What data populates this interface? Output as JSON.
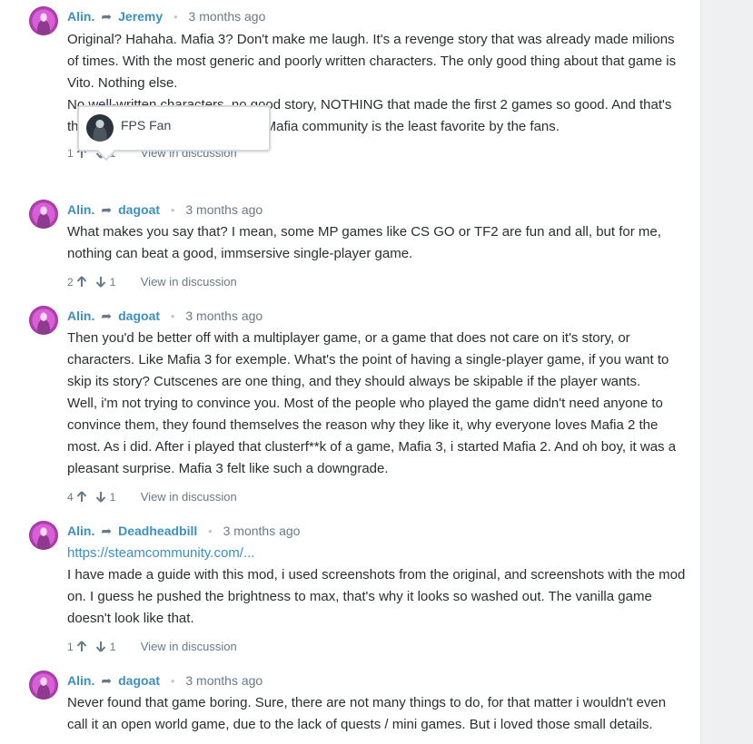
{
  "comments": [
    {
      "author": "Alin.",
      "reply_to": "Jeremy",
      "time": "3 months ago",
      "paragraphs": [
        "Original? Hahaha. Mafia 3? Don't make me laugh. It's a revenge story that was already made milions of times. With the most generic and poorly written characters. The only good thing about that game is Vito. Nothing else.",
        "No well-written characters, no good story, NOTHING that made the first 2 games so good. And that's the reason why that game in the Mafia community is the least favorite by the fans."
      ],
      "upvotes": "1",
      "downvotes": "1",
      "view_label": "View in discussion"
    },
    {
      "author": "Alin.",
      "reply_to": "dagoat",
      "time": "3 months ago",
      "paragraphs": [
        "What makes you say that? I mean, some MP games like CS GO or TF2 are fun and all, but for me, nothing can beat a good, immsersive single-player game."
      ],
      "upvotes": "2",
      "downvotes": "1",
      "view_label": "View in discussion"
    },
    {
      "author": "Alin.",
      "reply_to": "dagoat",
      "time": "3 months ago",
      "paragraphs": [
        "Then you'd be better off with a multiplayer game, or a game that does not care on it's story, or characters. Like Mafia 3 for exemple. What's the point of having a single-player game, if you want to skip its story? Cutscenes are one thing, and they should always be skipable if the player wants.",
        "Well, i'm not trying to convince you. Most of the people who played the game didn't need anyone to convince them, they found themselves the reason why they like it, why everyone loves Mafia 2 the most. As i did. After i played that clusterf**k of a game, Mafia 3, i started Mafia 2. And oh boy, it was a pleasant surprise. Mafia 3 felt like such a downgrade."
      ],
      "upvotes": "4",
      "downvotes": "1",
      "view_label": "View in discussion"
    },
    {
      "author": "Alin.",
      "reply_to": "Deadheadbill",
      "time": "3 months ago",
      "link": "https://steamcommunity.com/...",
      "paragraphs": [
        "I have made a guide with this mod, i used screenshots from the original, and screenshots with the mod on. I guess he pushed the brightness to max, that's why it looks so washed out. The vanilla game doesn't look like that."
      ],
      "upvotes": "1",
      "downvotes": "1",
      "view_label": "View in discussion"
    },
    {
      "author": "Alin.",
      "reply_to": "dagoat",
      "time": "3 months ago",
      "paragraphs": [
        "Never found that game boring. Sure, there are not many things to do, for that matter i wouldn't even call it an open world game, due to the lack of quests / mini games. But i loved those small details."
      ]
    }
  ],
  "tooltip": {
    "name": "FPS Fan"
  },
  "colors": {
    "link": "#3d8fbf",
    "meta": "#687a86",
    "text": "#2a2e2e"
  }
}
